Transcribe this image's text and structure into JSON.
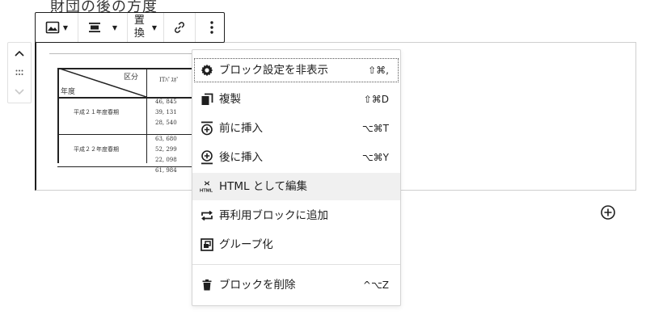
{
  "heading_text": "財団の後の方度",
  "toolbar": {
    "image_icon": "image-icon",
    "align_icon": "align-center-icon",
    "replace_label": "置換",
    "link_icon": "link-icon",
    "more_icon": "more-vertical-icon"
  },
  "mover": {
    "up_icon": "chevron-up-icon",
    "drag_icon": "drag-handle-icon",
    "down_icon": "chevron-down-icon"
  },
  "image_content": {
    "header_category": "区分",
    "header_year": "年度",
    "header_col": "ITﾊﾟｽﾎﾟ",
    "row1_label": "平成２１年度春期",
    "row1_values": [
      "46, 845",
      "39, 131",
      "28, 540"
    ],
    "row2_label": "平成２２年度春期",
    "row2_values": [
      "63, 680",
      "52, 299",
      "22, 098"
    ],
    "row3_partial": "61, 984"
  },
  "menu": {
    "items": [
      {
        "label": "ブロック設定を非表示",
        "shortcut": "⇧⌘,",
        "icon": "gear-icon"
      },
      {
        "label": "複製",
        "shortcut": "⇧⌘D",
        "icon": "duplicate-icon"
      },
      {
        "label": "前に挿入",
        "shortcut": "⌥⌘T",
        "icon": "insert-before-icon"
      },
      {
        "label": "後に挿入",
        "shortcut": "⌥⌘Y",
        "icon": "insert-after-icon"
      },
      {
        "label": "HTML として編集",
        "shortcut": "",
        "icon": "html-icon"
      },
      {
        "label": "再利用ブロックに追加",
        "shortcut": "",
        "icon": "reusable-block-icon"
      },
      {
        "label": "グループ化",
        "shortcut": "",
        "icon": "group-icon"
      },
      {
        "label": "ブロックを削除",
        "shortcut": "^⌥Z",
        "icon": "trash-icon"
      }
    ]
  },
  "add_block_icon": "plus-circle-icon",
  "colors": {
    "text": "#1e1e1e",
    "hover": "#f0f0f0",
    "border": "#d4d4d4"
  }
}
